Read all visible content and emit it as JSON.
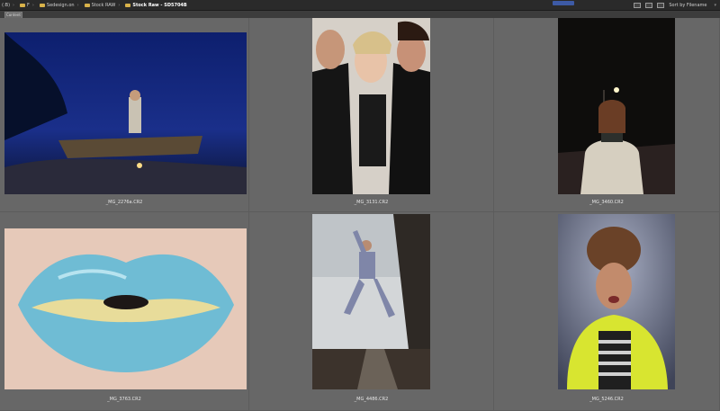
{
  "breadcrumb": {
    "items": [
      {
        "label": "(:B)"
      },
      {
        "label": "F"
      },
      {
        "label": "Sedesign.on"
      },
      {
        "label": "Stock RAW"
      },
      {
        "label": "Stock Raw - SD5704B"
      }
    ]
  },
  "toolbar": {
    "sort_label": "Sort by Filename"
  },
  "tabs": [
    {
      "label": "Content"
    }
  ],
  "thumbnails": [
    {
      "filename": "_MG_2276a.CR2",
      "icon": "night-lake-portrait"
    },
    {
      "filename": "_MG_3131.CR2",
      "icon": "fashion-trio-portrait"
    },
    {
      "filename": "_MG_3460.CR2",
      "icon": "night-street-portrait"
    },
    {
      "filename": "_MG_3763.CR2",
      "icon": "blue-lips-closeup"
    },
    {
      "filename": "_MG_4486.CR2",
      "icon": "bridge-pose-portrait"
    },
    {
      "filename": "_MG_5246.CR2",
      "icon": "yellow-jacket-portrait"
    }
  ]
}
